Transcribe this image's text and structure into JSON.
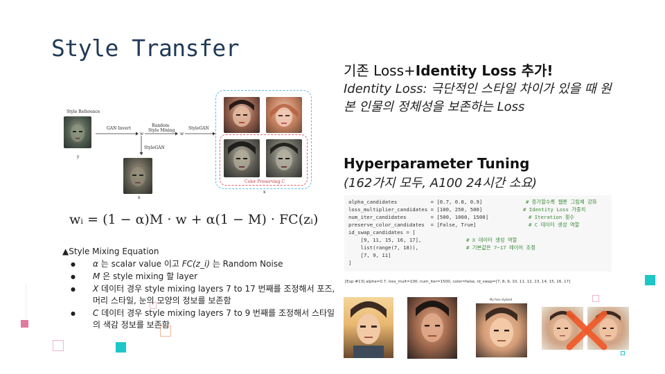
{
  "slide": {
    "title": "Style Transfer"
  },
  "diagram": {
    "style_reference_label": "Style Reference",
    "y_label": "y",
    "gan_invert_label": "GAN Invert",
    "w_label_1": "w",
    "random_label": "Random",
    "style_mixing_label": "Style Mixing",
    "w_label_2": "w",
    "stylegan_label_1": "StyleGAN",
    "stylegan_label_2": "StyleGAN",
    "x_label_left": "x",
    "color_preserving_label": "Color Preserving C",
    "x_label_right": "x"
  },
  "equation": {
    "text": "wᵢ = (1 − α)M · w + α(1 − M) · FC(zᵢ)"
  },
  "left_text": {
    "caption": "▲Style Mixing Equation",
    "bullets": [
      {
        "em": "α",
        "rest": " 는 scalar value 이고 ",
        "em2": "FC(z_i)",
        "rest2": " 는 Random Noise"
      },
      {
        "em": "M",
        "rest": " 은 style mixing 할 layer",
        "em2": "",
        "rest2": ""
      },
      {
        "em": "X",
        "rest": " 데이터 경우 style mixing layers 7 to 17 번째를 조정해서 포즈, 머리 스타일, 눈의 모양의 정보를 보존함",
        "em2": "",
        "rest2": ""
      },
      {
        "em": "C",
        "rest": " 데이터 경우 style mixing layers 7 to 9 번째를 조정해서 스타일의 색감 정보를 보존함",
        "em2": "",
        "rest2": ""
      }
    ]
  },
  "right_text": {
    "heading_prefix": "기존 Loss+",
    "heading_bold": "Identity Loss",
    "heading_suffix": " 추가!",
    "identity_desc": "Identity Loss: 극단적인 스타일 차이가 있을 때 원본 인물의 정체성을 보존하는 Loss",
    "hp_title": "Hyperparameter Tuning",
    "hp_sub": "(162가지 모두, A100 24시간 소요)"
  },
  "code": {
    "lines": [
      {
        "code": "alpha_candidates           = [0.7, 0.8, 0.9]",
        "comment": "# 증가할수록 웹툰 그림체 강화"
      },
      {
        "code": "loss_multiplier_candidates = [100, 250, 500]",
        "comment": "# Identity Loss 가중치"
      },
      {
        "code": "num_iter_candidates        = [500, 1000, 1500]",
        "comment": "# Iteration 횟수"
      },
      {
        "code": "preserve_color_candidates  = [False, True]",
        "comment": "# C 데이터 생성 역할"
      },
      {
        "code": "id_swap_candidates = [",
        "comment": ""
      },
      {
        "code": "    [9, 11, 15, 16, 17],",
        "comment": "# X 데이터 생성 역할"
      },
      {
        "code": "    list(range(7, 18)),",
        "comment": "# 기본값은 7~17 레이어 조정"
      },
      {
        "code": "    [7, 9, 11]",
        "comment": ""
      },
      {
        "code": "]",
        "comment": ""
      }
    ],
    "result": "[Exp #13] alpha=0.7, loss_mult=100, num_iter=1500, color=false, id_swap=[7, 8, 9, 10, 11, 12, 13, 14, 15, 16, 17]"
  },
  "photos": {
    "face3_caption": "My face stylized"
  },
  "colors": {
    "title": "#1f3a56",
    "accent_teal": "#1ec7c7",
    "accent_pink": "#e17a9b",
    "x_mark": "#ef5a2a"
  }
}
